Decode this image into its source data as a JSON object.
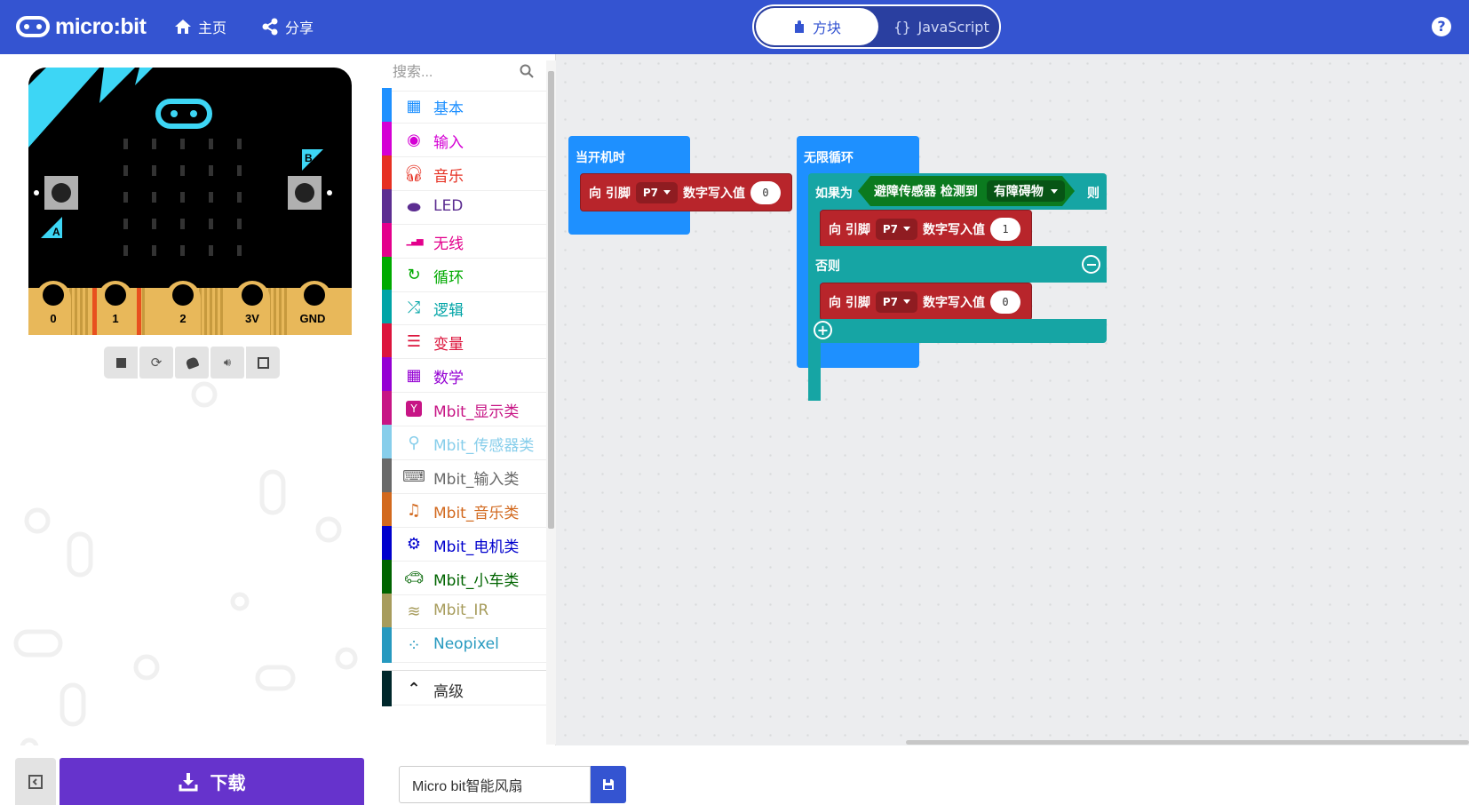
{
  "header": {
    "logo_text": "micro:bit",
    "home_label": "主页",
    "share_label": "分享",
    "blocks_label": "方块",
    "javascript_label": "JavaScript",
    "help_label": "?"
  },
  "simulator": {
    "pin_labels": [
      "0",
      "1",
      "2",
      "3V",
      "GND"
    ],
    "button_a": "A",
    "button_b": "B",
    "toolbar": [
      "stop-icon",
      "restart-icon",
      "debug-icon",
      "sound-icon",
      "fullscreen-icon"
    ]
  },
  "toolbox": {
    "search_placeholder": "搜索...",
    "categories": [
      {
        "label": "基本",
        "icon": "grid-icon",
        "color": "#1E90FF"
      },
      {
        "label": "输入",
        "icon": "target-icon",
        "color": "#D400D4"
      },
      {
        "label": "音乐",
        "icon": "headphones-icon",
        "color": "#E63022"
      },
      {
        "label": "LED",
        "icon": "toggle-icon",
        "color": "#5C2D91"
      },
      {
        "label": "无线",
        "icon": "signal-icon",
        "color": "#E3008C"
      },
      {
        "label": "循环",
        "icon": "loop-icon",
        "color": "#00AA00"
      },
      {
        "label": "逻辑",
        "icon": "shuffle-icon",
        "color": "#00A4A6"
      },
      {
        "label": "变量",
        "icon": "list-icon",
        "color": "#DC143C"
      },
      {
        "label": "数学",
        "icon": "calculator-icon",
        "color": "#9400D3"
      },
      {
        "label": "Mbit_显示类",
        "icon": "y-icon",
        "color": "#C71585"
      },
      {
        "label": "Mbit_传感器类",
        "icon": "sensor-icon",
        "color": "#87CEEB"
      },
      {
        "label": "Mbit_输入类",
        "icon": "keyboard-icon",
        "color": "#696969"
      },
      {
        "label": "Mbit_音乐类",
        "icon": "music-note-icon",
        "color": "#D2691E"
      },
      {
        "label": "Mbit_电机类",
        "icon": "gear-icon",
        "color": "#0000CD"
      },
      {
        "label": "Mbit_小车类",
        "icon": "car-icon",
        "color": "#006400"
      },
      {
        "label": "Mbit_IR",
        "icon": "wifi-icon",
        "color": "#A79C5C"
      },
      {
        "label": "Neopixel",
        "icon": "dots-circle-icon",
        "color": "#2699BF"
      },
      {
        "label": "高级",
        "icon": "chevron-up-icon",
        "color": "#00272B"
      }
    ]
  },
  "workspace": {
    "on_start": {
      "hat_label": "当开机时",
      "pin_block": {
        "prefix": "向 引脚",
        "pin": "P7",
        "action": "数字写入值",
        "value": "0"
      }
    },
    "forever": {
      "hat_label": "无限循环",
      "if_label": "如果为",
      "sensor_label": "避障传感器 检测到",
      "sensor_option": "有障碍物",
      "then_label": "则",
      "then_block": {
        "prefix": "向 引脚",
        "pin": "P7",
        "action": "数字写入值",
        "value": "1"
      },
      "else_label": "否则",
      "else_block": {
        "prefix": "向 引脚",
        "pin": "P7",
        "action": "数字写入值",
        "value": "0"
      }
    }
  },
  "bottom": {
    "download_label": "下载",
    "project_name": "Micro bit智能风扇"
  },
  "colors": {
    "header": "#3454D1",
    "download": "#6633CC",
    "pin_block": "#B8252B",
    "logic_block": "#16A5A4",
    "basic_block": "#1E90FF"
  }
}
